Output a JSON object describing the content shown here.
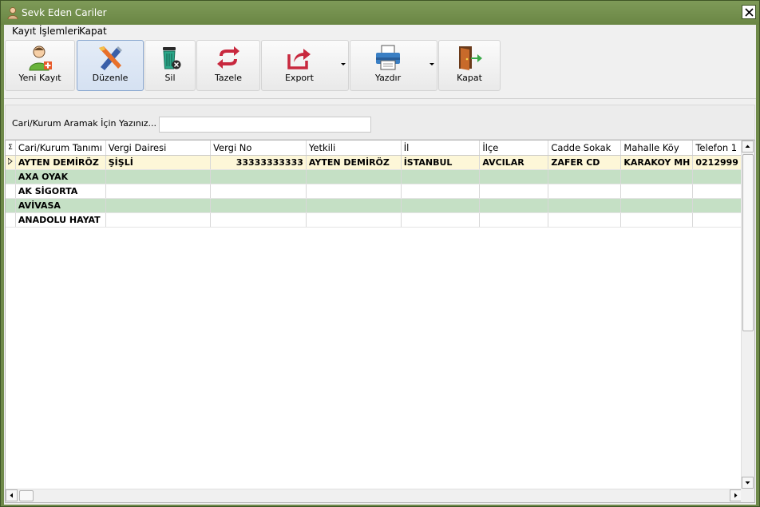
{
  "window": {
    "title": "Sevk Eden Cariler"
  },
  "menu": [
    {
      "label": "Kayıt İşlemleri"
    },
    {
      "label": "Kapat"
    }
  ],
  "toolbar": {
    "new": "Yeni Kayıt",
    "edit": "Düzenle",
    "delete": "Sil",
    "refresh": "Tazele",
    "export": "Export",
    "print": "Yazdır",
    "close": "Kapat"
  },
  "search": {
    "label": "Cari/Kurum Aramak İçin Yazınız...",
    "value": ""
  },
  "grid": {
    "indicator_header": "Σ",
    "columns": [
      "Cari/Kurum Tanımı",
      "Vergi Dairesi",
      "Vergi No",
      "Yetkili",
      "İl",
      "İlçe",
      "Cadde Sokak",
      "Mahalle Köy",
      "Telefon 1"
    ],
    "rows": [
      [
        "AYTEN DEMİRÖZ",
        "ŞİŞLİ",
        "33333333333",
        "AYTEN DEMİRÖZ",
        "İSTANBUL",
        "AVCILAR",
        "ZAFER CD",
        "KARAKOY MH",
        "0212999"
      ],
      [
        "AXA OYAK",
        "",
        "",
        "",
        "",
        "",
        "",
        "",
        ""
      ],
      [
        "AK SİGORTA",
        "",
        "",
        "",
        "",
        "",
        "",
        "",
        ""
      ],
      [
        "AVİVASA",
        "",
        "",
        "",
        "",
        "",
        "",
        "",
        ""
      ],
      [
        "ANADOLU HAYAT",
        "",
        "",
        "",
        "",
        "",
        "",
        "",
        ""
      ]
    ]
  },
  "colors": {
    "window_frame": "#6f8a4a",
    "selected_row": "#fdf7d8",
    "alt_row": "#c5e0c5"
  }
}
